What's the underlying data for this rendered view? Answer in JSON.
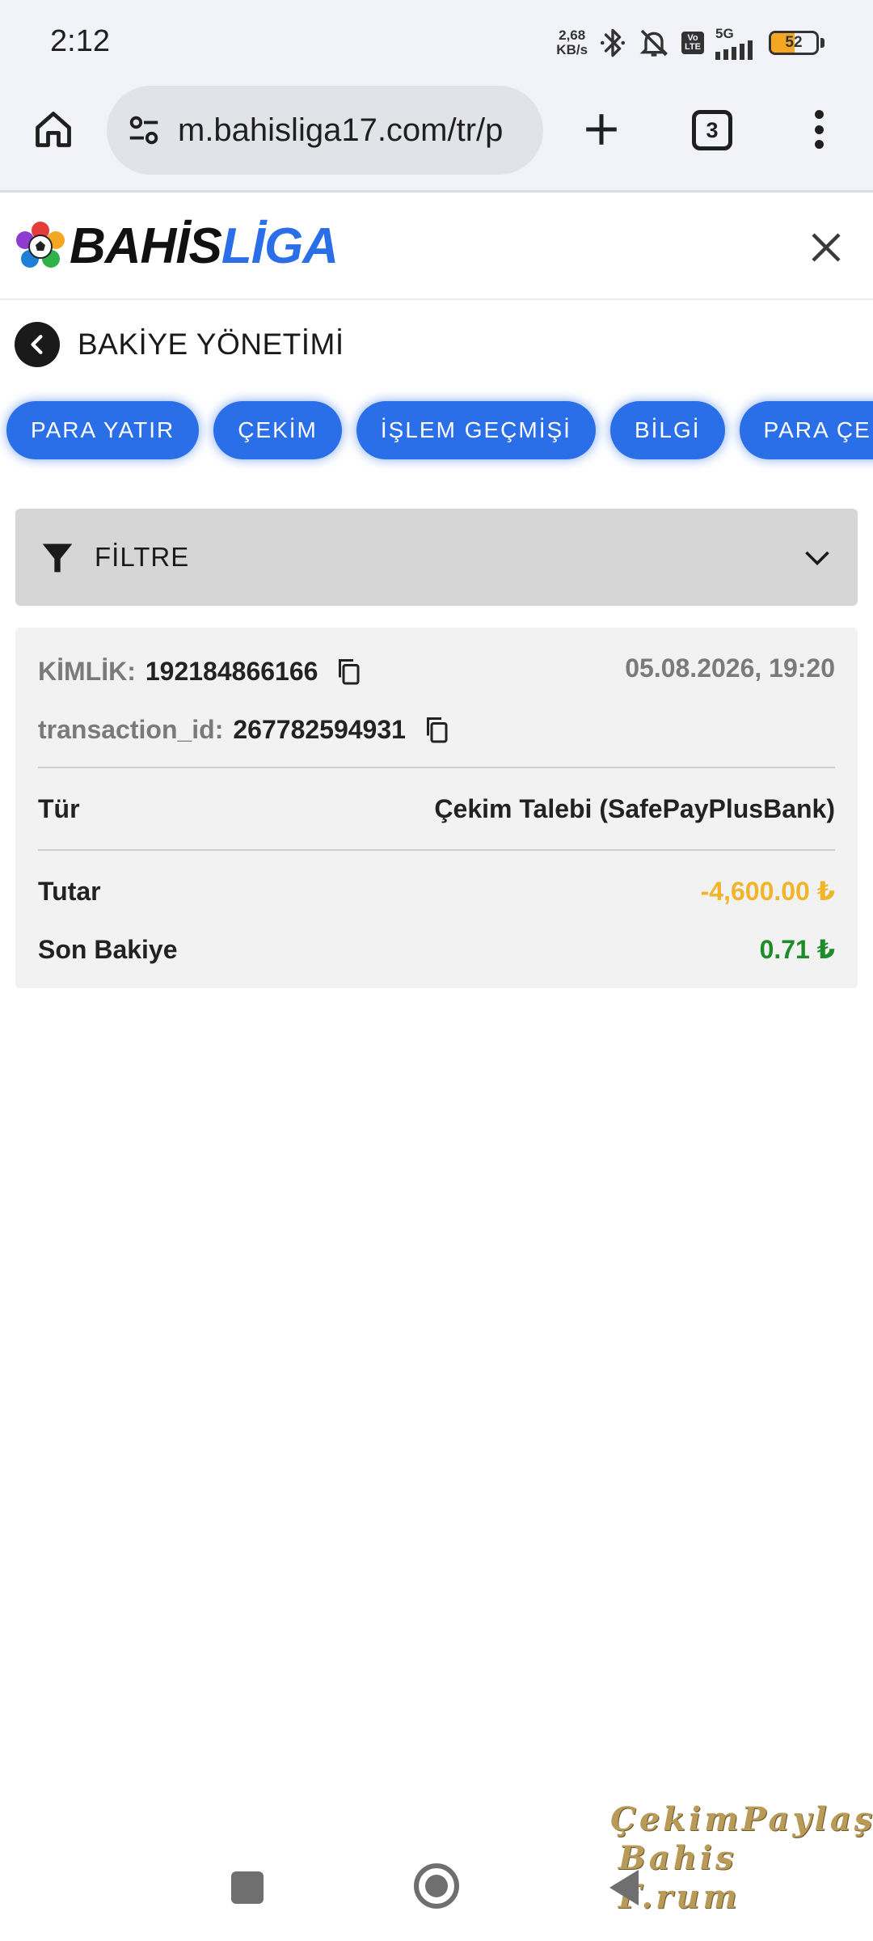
{
  "status_bar": {
    "time": "2:12",
    "speed_value": "2,68",
    "speed_unit": "KB/s",
    "volte_top": "Vo",
    "volte_bottom": "LTE",
    "network": "5G",
    "battery_percent": 52,
    "battery_label": "52",
    "battery_color": "#f5a623"
  },
  "browser": {
    "url": "m.bahisliga17.com/tr/p",
    "tab_count": "3",
    "icons": [
      "home-icon",
      "site-settings-icon",
      "new-tab-plus-icon",
      "tab-switcher-icon",
      "more-menu-icon"
    ]
  },
  "site": {
    "logo_part1": "BAHİS",
    "logo_part2": "LİGA",
    "brand_color": "#2a6ee8"
  },
  "page": {
    "title": "BAKİYE YÖNETİMİ"
  },
  "tabs": [
    {
      "label": "PARA YATIR"
    },
    {
      "label": "ÇEKİM"
    },
    {
      "label": "İŞLEM GEÇMİŞİ"
    },
    {
      "label": "BİLGİ"
    },
    {
      "label": "PARA ÇEKME"
    }
  ],
  "filter": {
    "label": "FİLTRE"
  },
  "transaction": {
    "id_label": "KİMLİK:",
    "id_value": "192184866166",
    "date": "05.08.2026, 19:20",
    "tx_label": "transaction_id:",
    "tx_value": "267782594931",
    "type_label": "Tür",
    "type_value": "Çekim Talebi (SafePayPlusBank)",
    "amount_label": "Tutar",
    "amount_value": "-4,600.00 ₺",
    "balance_label": "Son Bakiye",
    "balance_value": "0.71 ₺",
    "amount_color": "#f0b52a",
    "balance_color": "#1e8c2a"
  },
  "watermark": {
    "line1": "ÇekimPaylaş",
    "line2": "Bahis F.rum"
  }
}
